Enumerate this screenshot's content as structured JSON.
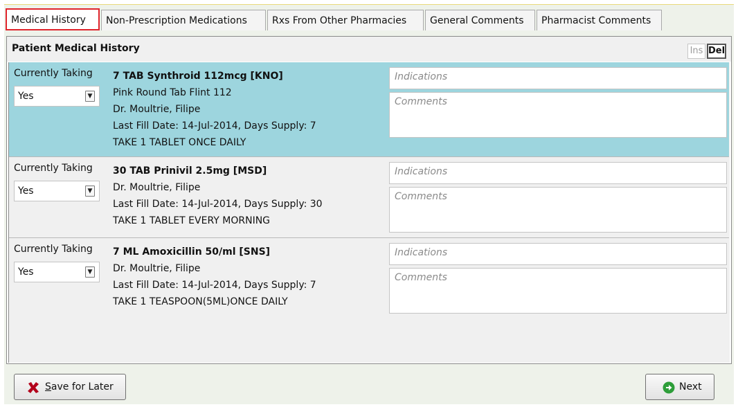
{
  "tabs": [
    {
      "label": "Medical History",
      "active": true
    },
    {
      "label": "Non-Prescription Medications",
      "active": false
    },
    {
      "label": "Rxs From Other Pharmacies",
      "active": false
    },
    {
      "label": "General Comments",
      "active": false
    },
    {
      "label": "Pharmacist Comments",
      "active": false
    }
  ],
  "panel": {
    "title": "Patient Medical History",
    "ins_label": "Ins",
    "del_label": "Del"
  },
  "rows": [
    {
      "status_label": "Currently Taking",
      "status_value": "Yes",
      "drug": "7 TAB Synthroid 112mcg [KNO]",
      "description": "Pink Round Tab Flint 112",
      "doctor": "Dr. Moultrie, Filipe",
      "fill_info": "Last Fill Date: 14-Jul-2014, Days Supply: 7",
      "sig": "TAKE 1 TABLET ONCE DAILY",
      "indications_placeholder": "Indications",
      "comments_placeholder": "Comments",
      "selected": true
    },
    {
      "status_label": "Currently Taking",
      "status_value": "Yes",
      "drug": "30 TAB Prinivil 2.5mg [MSD]",
      "doctor": "Dr. Moultrie, Filipe",
      "fill_info": "Last Fill Date: 14-Jul-2014, Days Supply: 30",
      "sig": "TAKE 1 TABLET EVERY MORNING",
      "indications_placeholder": "Indications",
      "comments_placeholder": "Comments",
      "selected": false
    },
    {
      "status_label": "Currently Taking",
      "status_value": "Yes",
      "drug": "7 ML Amoxicillin 50/ml [SNS]",
      "doctor": "Dr. Moultrie, Filipe",
      "fill_info": "Last Fill Date: 14-Jul-2014, Days Supply: 7",
      "sig": "TAKE 1 TEASPOON(5ML)ONCE DAILY",
      "indications_placeholder": "Indications",
      "comments_placeholder": "Comments",
      "selected": false
    }
  ],
  "footer": {
    "save_first_letter": "S",
    "save_rest": "ave for Later",
    "next_label": "Next"
  },
  "colors": {
    "selected_row": "#9dd5de",
    "active_tab_outline": "#e0242c",
    "save_icon": "#b3001b",
    "next_icon": "#2e9e3a"
  },
  "icons": {
    "save": "x-icon",
    "next": "arrow-right-circle-icon",
    "dropdown": "chevron-down-icon"
  }
}
